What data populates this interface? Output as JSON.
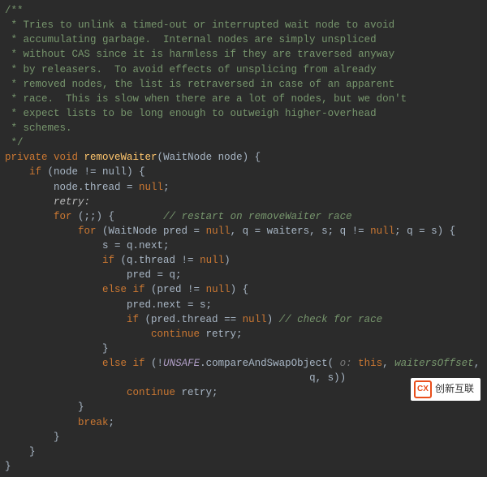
{
  "code": {
    "comment_lines": [
      "/**",
      " * Tries to unlink a timed-out or interrupted wait node to avoid",
      " * accumulating garbage.  Internal nodes are simply unspliced",
      " * without CAS since it is harmless if they are traversed anyway",
      " * by releasers.  To avoid effects of unsplicing from already",
      " * removed nodes, the list is retraversed in case of an apparent",
      " * race.  This is slow when there are a lot of nodes, but we don't",
      " * expect lists to be long enough to outweigh higher-overhead",
      " * schemes.",
      " */"
    ],
    "signature": {
      "modifiers": "private void",
      "name": "removeWaiter",
      "param_type": "WaitNode",
      "param_name": "node"
    },
    "body": {
      "if_cond": "node != null",
      "stmt1_lhs": "node.thread",
      "stmt1_rhs": "null",
      "label": "retry:",
      "for_outer": "for (;;) {",
      "outer_comment": "// restart on removeWaiter race",
      "for_inner": "for (WaitNode pred = null, q = waiters, s; q != null; q = s) {",
      "inner": {
        "l1": "s = q.next;",
        "l2": "if (q.thread != null)",
        "l3": "pred = q;",
        "l4": "else if (pred != null) {",
        "l5": "pred.next = s;",
        "l6_if": "if (pred.thread == null)",
        "l6_comment": "// check for race",
        "l7": "continue retry;",
        "l8": "}",
        "l9a": "else if (!",
        "l9_obj": "UNSAFE",
        "l9b": ".compareAndSwapObject(",
        "l9_hint": " o: ",
        "l9c": "this, ",
        "l9d": "waitersOffset",
        "l9e": ",",
        "l10": "q, s))",
        "l11": "continue retry;"
      },
      "break": "break;"
    }
  },
  "watermark": {
    "logo_text": "CX",
    "text": "创新互联"
  }
}
